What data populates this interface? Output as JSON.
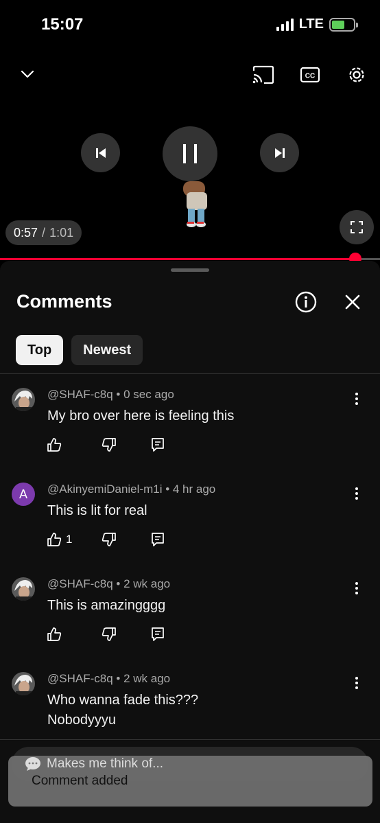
{
  "status_bar": {
    "time": "15:07",
    "network": "LTE"
  },
  "player": {
    "current_time": "0:57",
    "separator": "/",
    "total_time": "1:01",
    "progress": 0.935,
    "icons": [
      "chevron-down-icon",
      "cast-icon",
      "captions-icon",
      "settings-icon",
      "skip-previous-icon",
      "pause-icon",
      "skip-next-icon",
      "fullscreen-icon"
    ]
  },
  "comments": {
    "title": "Comments",
    "filters": [
      {
        "label": "Top",
        "active": true
      },
      {
        "label": "Newest",
        "active": false
      }
    ],
    "items": [
      {
        "author": "@SHAF-c8q",
        "time": "0 sec ago",
        "text": "My bro over here is feeling this",
        "likes": "",
        "avatar": "photo"
      },
      {
        "author": "@AkinyemiDaniel-m1i",
        "time": "4 hr ago",
        "text": "This is lit for real",
        "likes": "1",
        "avatar": "A"
      },
      {
        "author": "@SHAF-c8q",
        "time": "2 wk ago",
        "text": "This is amazingggg",
        "likes": "",
        "avatar": "photo"
      },
      {
        "author": "@SHAF-c8q",
        "time": "2 wk ago",
        "text": "Who wanna fade this???",
        "text2": "Nobodyyyu",
        "likes": "",
        "avatar": "photo"
      }
    ],
    "input_placeholder": "Makes me think of...",
    "toast": "Comment added"
  },
  "colors": {
    "accent": "#ff0033",
    "background": "#0f0f0f"
  }
}
